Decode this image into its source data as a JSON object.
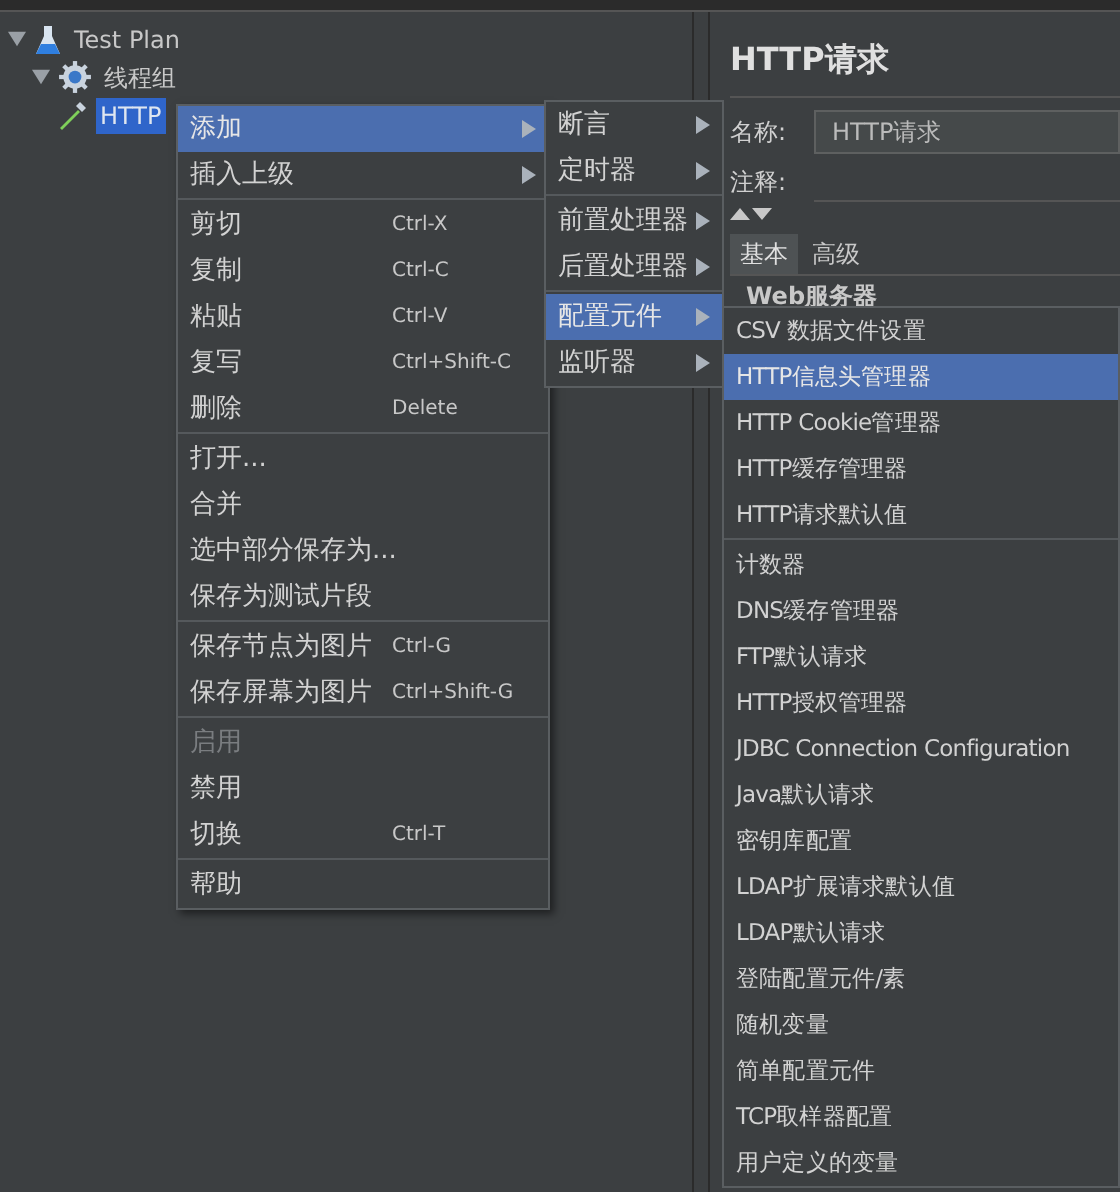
{
  "tree": [
    {
      "label": "Test Plan",
      "kind": "plan",
      "expanded": true,
      "selected": false
    },
    {
      "label": "线程组",
      "kind": "group",
      "expanded": true,
      "selected": false
    },
    {
      "label": "HTTP",
      "kind": "sampler",
      "selected": true
    }
  ],
  "panel": {
    "title": "HTTP请求",
    "name_label": "名称:",
    "name_value": "HTTP请求",
    "comment_label": "注释:",
    "tabs": [
      {
        "label": "基本",
        "selected": true
      },
      {
        "label": "高级",
        "selected": false
      }
    ],
    "section": "Web服务器"
  },
  "context_menu": {
    "groups": [
      [
        {
          "label": "添加",
          "submenu": true,
          "selected": true,
          "disabled": false
        },
        {
          "label": "插入上级",
          "submenu": true,
          "selected": false,
          "disabled": false
        }
      ],
      [
        {
          "label": "剪切",
          "shortcut": "Ctrl-X",
          "selected": false,
          "disabled": false
        },
        {
          "label": "复制",
          "shortcut": "Ctrl-C",
          "selected": false,
          "disabled": false
        },
        {
          "label": "粘贴",
          "shortcut": "Ctrl-V",
          "selected": false,
          "disabled": false
        },
        {
          "label": "复写",
          "shortcut": "Ctrl+Shift-C",
          "selected": false,
          "disabled": false
        },
        {
          "label": "删除",
          "shortcut": "Delete",
          "selected": false,
          "disabled": false
        }
      ],
      [
        {
          "label": "打开...",
          "selected": false,
          "disabled": false
        },
        {
          "label": "合并",
          "selected": false,
          "disabled": false
        },
        {
          "label": "选中部分保存为...",
          "selected": false,
          "disabled": false
        },
        {
          "label": "保存为测试片段",
          "selected": false,
          "disabled": false
        }
      ],
      [
        {
          "label": "保存节点为图片",
          "shortcut": "Ctrl-G",
          "selected": false,
          "disabled": false
        },
        {
          "label": "保存屏幕为图片",
          "shortcut": "Ctrl+Shift-G",
          "selected": false,
          "disabled": false
        }
      ],
      [
        {
          "label": "启用",
          "selected": false,
          "disabled": true
        },
        {
          "label": "禁用",
          "selected": false,
          "disabled": false
        },
        {
          "label": "切换",
          "shortcut": "Ctrl-T",
          "selected": false,
          "disabled": false
        }
      ],
      [
        {
          "label": "帮助",
          "selected": false,
          "disabled": false
        }
      ]
    ]
  },
  "add_menu": {
    "groups": [
      [
        {
          "label": "断言",
          "submenu": true,
          "selected": false
        },
        {
          "label": "定时器",
          "submenu": true,
          "selected": false
        }
      ],
      [
        {
          "label": "前置处理器",
          "submenu": true,
          "selected": false
        },
        {
          "label": "后置处理器",
          "submenu": true,
          "selected": false
        }
      ],
      [
        {
          "label": "配置元件",
          "submenu": true,
          "selected": true
        },
        {
          "label": "监听器",
          "submenu": true,
          "selected": false
        }
      ]
    ]
  },
  "config_menu": {
    "groups": [
      [
        {
          "label": "CSV 数据文件设置",
          "selected": false
        },
        {
          "label": "HTTP信息头管理器",
          "selected": true
        },
        {
          "label": "HTTP Cookie管理器",
          "selected": false
        },
        {
          "label": "HTTP缓存管理器",
          "selected": false
        },
        {
          "label": "HTTP请求默认值",
          "selected": false
        }
      ],
      [
        {
          "label": "计数器",
          "selected": false
        },
        {
          "label": "DNS缓存管理器",
          "selected": false
        },
        {
          "label": "FTP默认请求",
          "selected": false
        },
        {
          "label": "HTTP授权管理器",
          "selected": false
        },
        {
          "label": "JDBC Connection Configuration",
          "selected": false
        },
        {
          "label": "Java默认请求",
          "selected": false
        },
        {
          "label": "密钥库配置",
          "selected": false
        },
        {
          "label": "LDAP扩展请求默认值",
          "selected": false
        },
        {
          "label": "LDAP默认请求",
          "selected": false
        },
        {
          "label": "登陆配置元件/素",
          "selected": false
        },
        {
          "label": "随机变量",
          "selected": false
        },
        {
          "label": "简单配置元件",
          "selected": false
        },
        {
          "label": "TCP取样器配置",
          "selected": false
        },
        {
          "label": "用户定义的变量",
          "selected": false
        }
      ]
    ]
  }
}
